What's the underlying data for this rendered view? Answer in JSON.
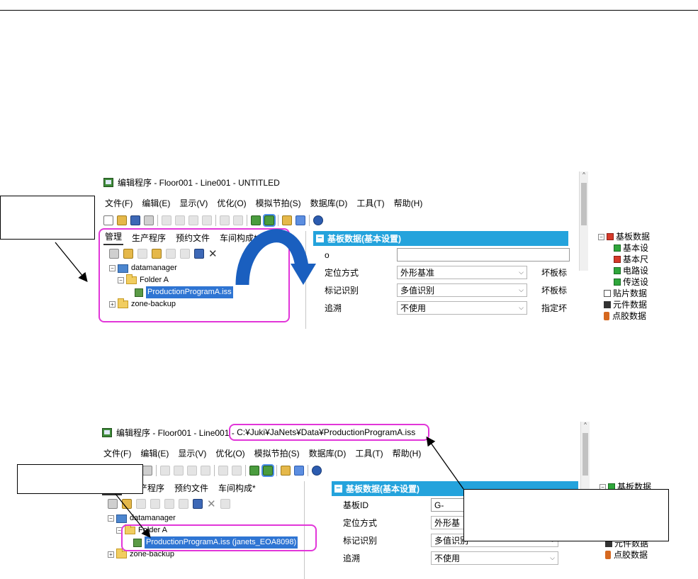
{
  "common": {
    "menu": [
      "文件(F)",
      "编辑(E)",
      "显示(V)",
      "优化(O)",
      "模拟节拍(S)",
      "数据库(D)",
      "工具(T)",
      "帮助(H)"
    ],
    "tabs": [
      "管理",
      "生产程序",
      "预约文件",
      "车间构成*"
    ],
    "tree": {
      "root": "datamanager",
      "folder": "Folder A",
      "zone": "zone-backup"
    },
    "panel_header": "基板数据(基本设置)",
    "form": {
      "id_label_partial": "o",
      "id_label": "基板ID",
      "id_value": "G-",
      "positioning_label_partial": "定位方式",
      "positioning_label": "定位方式",
      "positioning_value": "外形基准",
      "positioning_value_clipped": "外形基",
      "mark_label": "标记识别",
      "mark_value": "多值识别",
      "trace_label": "追溯",
      "trace_value": "不使用",
      "right_labels": [
        "坏板标",
        "坏板标",
        "指定坏"
      ]
    },
    "right_tree": {
      "board": "基板数据",
      "basic_set": "基本设",
      "basic_size": "基本尺",
      "circuit": "电路设",
      "transfer": "传送设",
      "placement": "贴片数据",
      "component": "元件数据",
      "dispense": "点胶数据"
    }
  },
  "shot1": {
    "title": "编辑程序 - Floor001 - Line001 - UNTITLED",
    "program_item": "ProductionProgramA.iss",
    "scroll_up": "^"
  },
  "shot2": {
    "title_prefix": "编辑程序 - Floor001 - Line001 - ",
    "title_path": "C:¥Juki¥JaNets¥Data¥ProductionProgramA.iss",
    "program_item": "ProductionProgramA.iss (janets_EOA8098)"
  },
  "colors": {
    "highlight": "#e236d9",
    "panel_header": "#24a3dc",
    "selection": "#2f75d3",
    "big_arrow": "#1a5fbf"
  }
}
